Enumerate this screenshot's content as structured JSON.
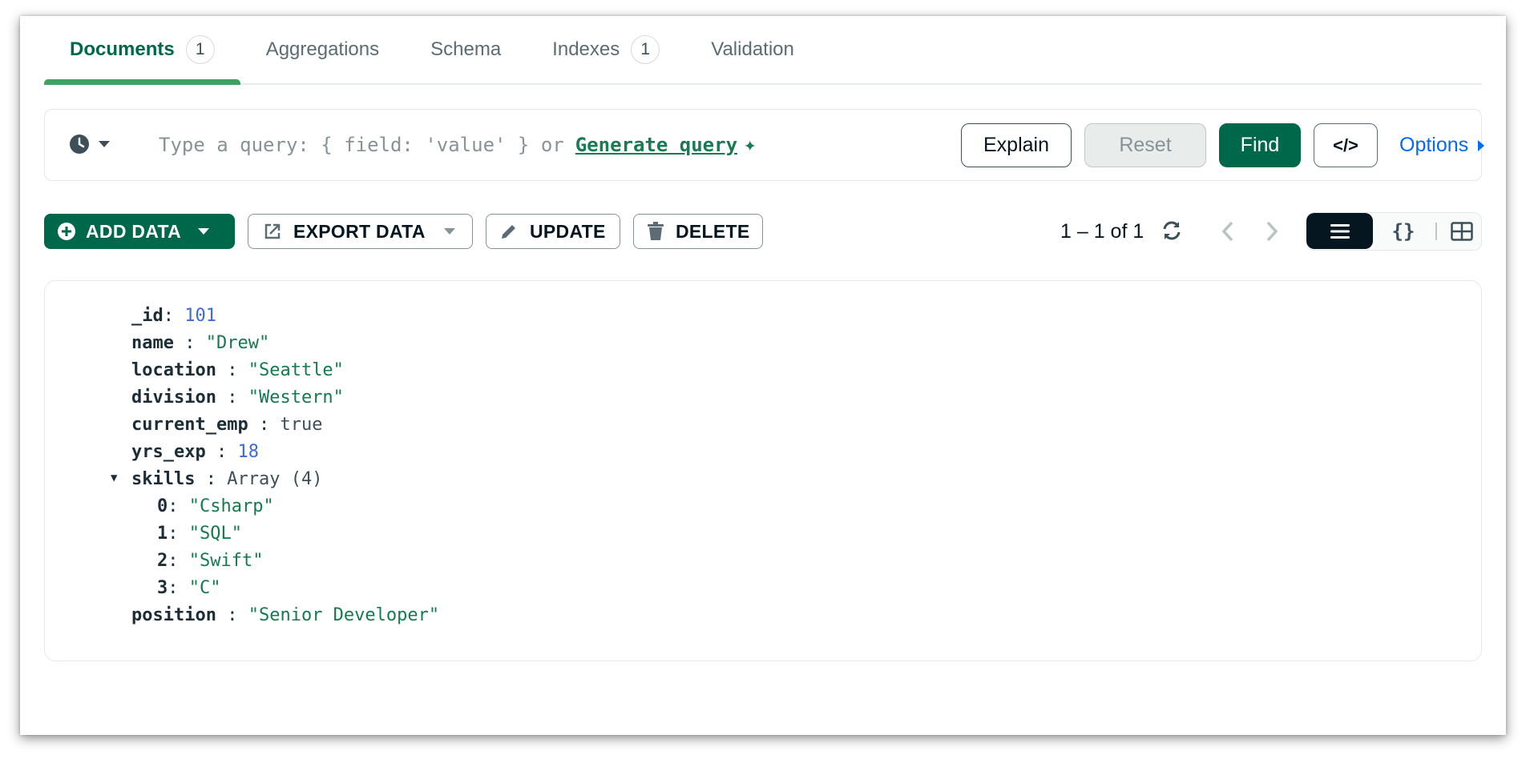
{
  "tabs": [
    {
      "label": "Documents",
      "count": "1",
      "active": true
    },
    {
      "label": "Aggregations"
    },
    {
      "label": "Schema"
    },
    {
      "label": "Indexes",
      "count": "1"
    },
    {
      "label": "Validation"
    }
  ],
  "query": {
    "placeholder": "Type a query: { field: 'value' } or",
    "generate_link": "Generate query",
    "explain": "Explain",
    "reset": "Reset",
    "find": "Find",
    "code": "</>",
    "options": "Options"
  },
  "toolbar": {
    "add_data": "ADD DATA",
    "export_data": "EXPORT DATA",
    "update": "UPDATE",
    "delete": "DELETE",
    "page_info": "1 – 1 of 1",
    "json_view": "{}"
  },
  "document": {
    "id_key": "_id",
    "id_val": "101",
    "name_key": "name",
    "name_val": "\"Drew\"",
    "location_key": "location",
    "location_val": "\"Seattle\"",
    "division_key": "division",
    "division_val": "\"Western\"",
    "current_emp_key": "current_emp",
    "current_emp_val": "true",
    "yrs_exp_key": "yrs_exp",
    "yrs_exp_val": "18",
    "skills_key": "skills",
    "skills_val": "Array (4)",
    "skills": [
      {
        "idx": "0",
        "val": "\"Csharp\""
      },
      {
        "idx": "1",
        "val": "\"SQL\""
      },
      {
        "idx": "2",
        "val": "\"Swift\""
      },
      {
        "idx": "3",
        "val": "\"C\""
      }
    ],
    "position_key": "position",
    "position_val": "\"Senior Developer\""
  },
  "colors": {
    "brand_green": "#00684a",
    "active_tab_underline": "#3ea25f",
    "link_blue": "#016bf8",
    "string_green": "#157a4e",
    "number_blue": "#3d6bd6"
  }
}
